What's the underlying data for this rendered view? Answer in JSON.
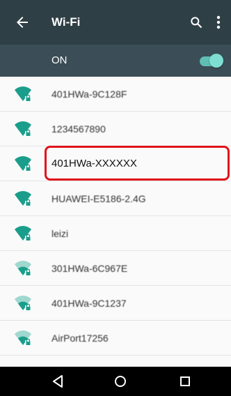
{
  "app": {
    "title": "Wi-Fi"
  },
  "wifi_toggle": {
    "label": "ON",
    "state": "on"
  },
  "networks": [
    {
      "ssid": "401HWa-9C128F",
      "signal": "full",
      "secured": true
    },
    {
      "ssid": "1234567890",
      "signal": "full",
      "secured": true
    },
    {
      "ssid": "401HWa-XXXXXX",
      "signal": "full",
      "secured": true,
      "highlighted": true
    },
    {
      "ssid": "HUAWEI-E5186-2.4G",
      "signal": "full",
      "secured": true
    },
    {
      "ssid": "leizi",
      "signal": "full",
      "secured": true
    },
    {
      "ssid": "301HWa-6C967E",
      "signal": "medium",
      "secured": true
    },
    {
      "ssid": "401HWa-9C1237",
      "signal": "medium",
      "secured": true
    },
    {
      "ssid": "AirPort17256",
      "signal": "medium",
      "secured": true
    }
  ],
  "icons": {
    "back": "arrow-back-icon",
    "search": "search-icon",
    "more": "more-vert-icon",
    "wifi": "wifi-lock-icon",
    "nav_back": "triangle-back-icon",
    "nav_home": "circle-home-icon",
    "nav_recents": "square-recents-icon"
  },
  "colors": {
    "appbar": "#2f3f46",
    "toggle_bar": "#3b4d56",
    "accent": "#5fbfb5",
    "wifi_icon": "#1a9e8b",
    "highlight": "#e0131a"
  }
}
